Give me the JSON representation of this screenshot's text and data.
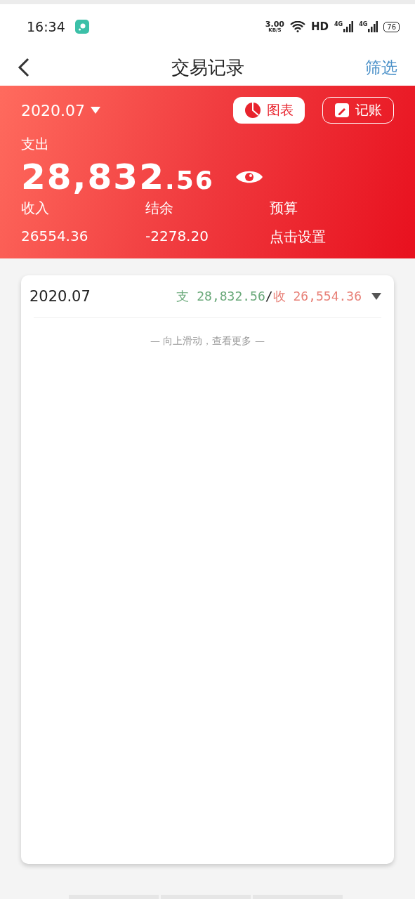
{
  "status_bar": {
    "time": "16:34",
    "speed_value": "3.00",
    "speed_unit": "KB/S",
    "hd": "HD",
    "network_1": "4G",
    "network_2": "4G",
    "battery": "76"
  },
  "nav": {
    "title": "交易记录",
    "action": "筛选"
  },
  "summary": {
    "month": "2020.07",
    "chart_button": "图表",
    "record_button": "记账",
    "expense_label": "支出",
    "expense_int": "28,832",
    "expense_dec": ".56",
    "stats": [
      {
        "label": "收入",
        "value": "26554.36"
      },
      {
        "label": "结余",
        "value": "-2278.20"
      },
      {
        "label": "预算",
        "value": "点击设置"
      }
    ]
  },
  "month_card": {
    "month": "2020.07",
    "expense_prefix": "支",
    "expense": "28,832.56",
    "separator": "/",
    "income_prefix": "收",
    "income": "26,554.36",
    "expanded": true,
    "hint": "— 向上滑动，查看更多 —"
  }
}
